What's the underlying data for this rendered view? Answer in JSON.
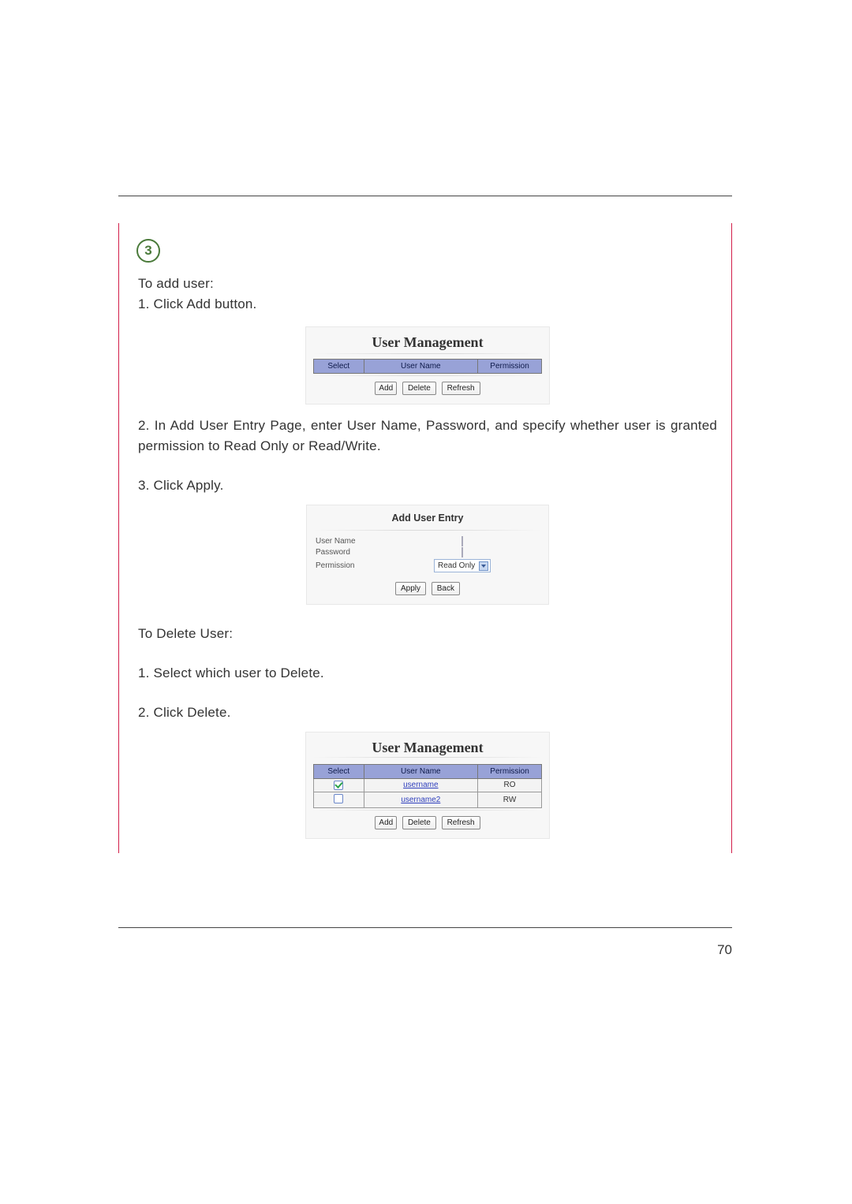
{
  "pageNumber": "70",
  "stepBadge": "3",
  "text": {
    "toAdd": "To add user:",
    "step1a": "1. Click Add button.",
    "step2a": "2. In Add User Entry Page, enter User Name, Password, and specify whether user is granted permission to Read Only or Read/Write.",
    "step3a": "3. Click Apply.",
    "toDelete": "To Delete User:",
    "step1d": "1. Select which user to Delete.",
    "step2d": "2. Click Delete."
  },
  "panel1": {
    "title": "User Management",
    "cols": {
      "select": "Select",
      "user": "User Name",
      "perm": "Permission"
    },
    "buttons": {
      "add": "Add",
      "delete": "Delete",
      "refresh": "Refresh"
    }
  },
  "panel2": {
    "title": "Add User Entry",
    "labels": {
      "user": "User Name",
      "pwd": "Password",
      "perm": "Permission"
    },
    "permValue": "Read Only",
    "buttons": {
      "apply": "Apply",
      "back": "Back"
    }
  },
  "panel3": {
    "title": "User Management",
    "cols": {
      "select": "Select",
      "user": "User Name",
      "perm": "Permission"
    },
    "rows": [
      {
        "checked": true,
        "user": "username",
        "perm": "RO"
      },
      {
        "checked": false,
        "user": "username2",
        "perm": "RW"
      }
    ],
    "buttons": {
      "add": "Add",
      "delete": "Delete",
      "refresh": "Refresh"
    }
  }
}
